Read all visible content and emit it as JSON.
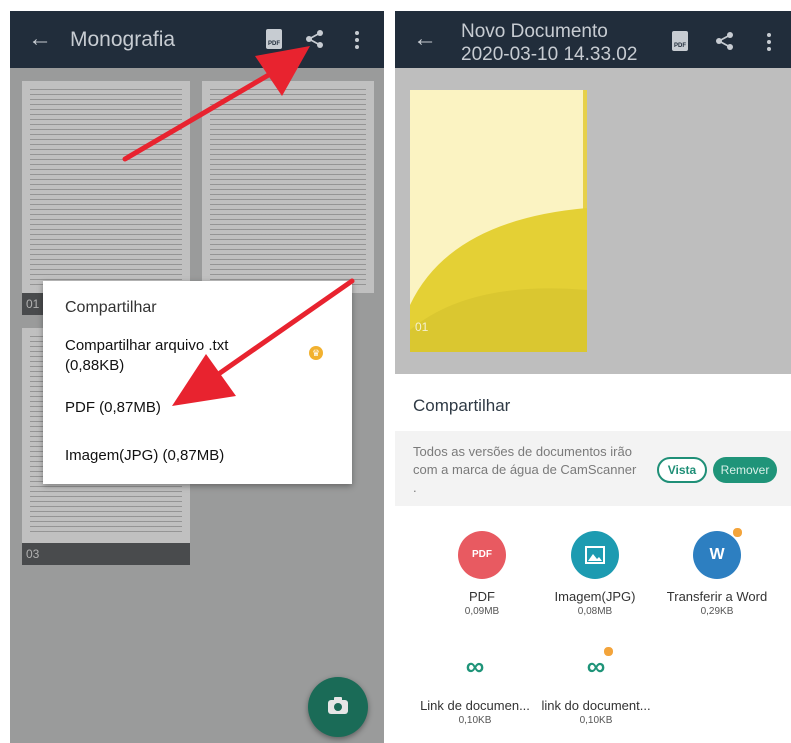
{
  "colors": {
    "topbar": "#212d3b",
    "accent": "#1f9479",
    "pdf_red": "#e85a61",
    "image_teal": "#1d9bb1",
    "word_blue": "#2d7fc1",
    "premium": "#f3a43b",
    "arrow": "#e8232f"
  },
  "left": {
    "topbar": {
      "back_icon": "arrow-left",
      "title": "Monografia",
      "pdf_label": "PDF",
      "share_icon": "share",
      "menu_icon": "more-vert"
    },
    "pages": [
      "01",
      "03"
    ],
    "dialog": {
      "title": "Compartilhar",
      "options": [
        {
          "label": "Compartilhar arquivo .txt",
          "size": "(0,88KB)",
          "premium_icon": "crown"
        },
        {
          "label": "PDF (0,87MB)"
        },
        {
          "label": "Imagem(JPG) (0,87MB)"
        }
      ]
    },
    "fab_icon": "camera"
  },
  "right": {
    "topbar": {
      "back_icon": "arrow-left",
      "title_line1": "Novo Documento",
      "title_line2": "2020-03-10 14.33.02",
      "pdf_label": "PDF",
      "share_icon": "share",
      "menu_icon": "more-vert"
    },
    "page_label": "01",
    "sheet": {
      "title": "Compartilhar",
      "notice": "Todos as versões de documentos irão com a marca de água de CamScanner .",
      "vista_label": "Vista",
      "remover_label": "Remover",
      "items": [
        {
          "label": "PDF",
          "size": "0,09MB",
          "icon": "pdf-icon"
        },
        {
          "label": "Imagem(JPG)",
          "size": "0,08MB",
          "icon": "image-icon"
        },
        {
          "label": "Transferir a Word",
          "size": "0,29KB",
          "icon": "word-icon",
          "premium": true
        },
        {
          "label": "Link de documen...",
          "size": "0,10KB",
          "icon": "link-icon"
        },
        {
          "label": "link do document...",
          "size": "0,10KB",
          "icon": "link-lock-icon",
          "premium": true
        }
      ]
    }
  }
}
